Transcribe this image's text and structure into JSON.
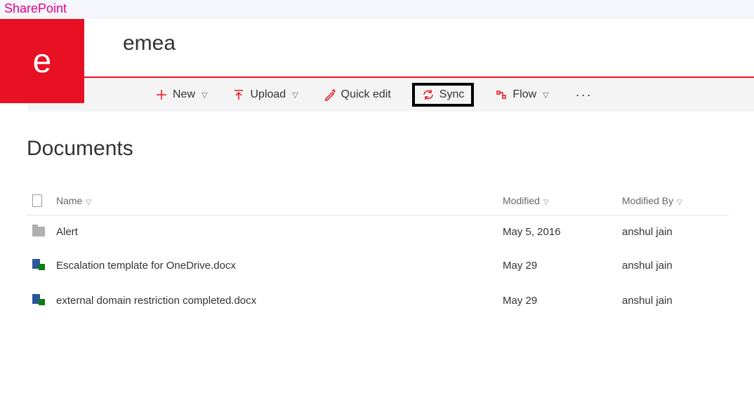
{
  "suite": {
    "brand": "SharePoint"
  },
  "site": {
    "initial": "e",
    "title": "emea"
  },
  "toolbar": {
    "new": "New",
    "upload": "Upload",
    "quickedit": "Quick edit",
    "sync": "Sync",
    "flow": "Flow"
  },
  "library": {
    "title": "Documents"
  },
  "columns": {
    "name": "Name",
    "modified": "Modified",
    "modifiedBy": "Modified By"
  },
  "rows": [
    {
      "type": "folder",
      "name": "Alert",
      "modified": "May 5, 2016",
      "by": "anshul jain"
    },
    {
      "type": "docx",
      "name": "Escalation template for OneDrive.docx",
      "modified": "May 29",
      "by": "anshul jain"
    },
    {
      "type": "docx",
      "name": "external domain restriction completed.docx",
      "modified": "May 29",
      "by": "anshul jain"
    }
  ]
}
